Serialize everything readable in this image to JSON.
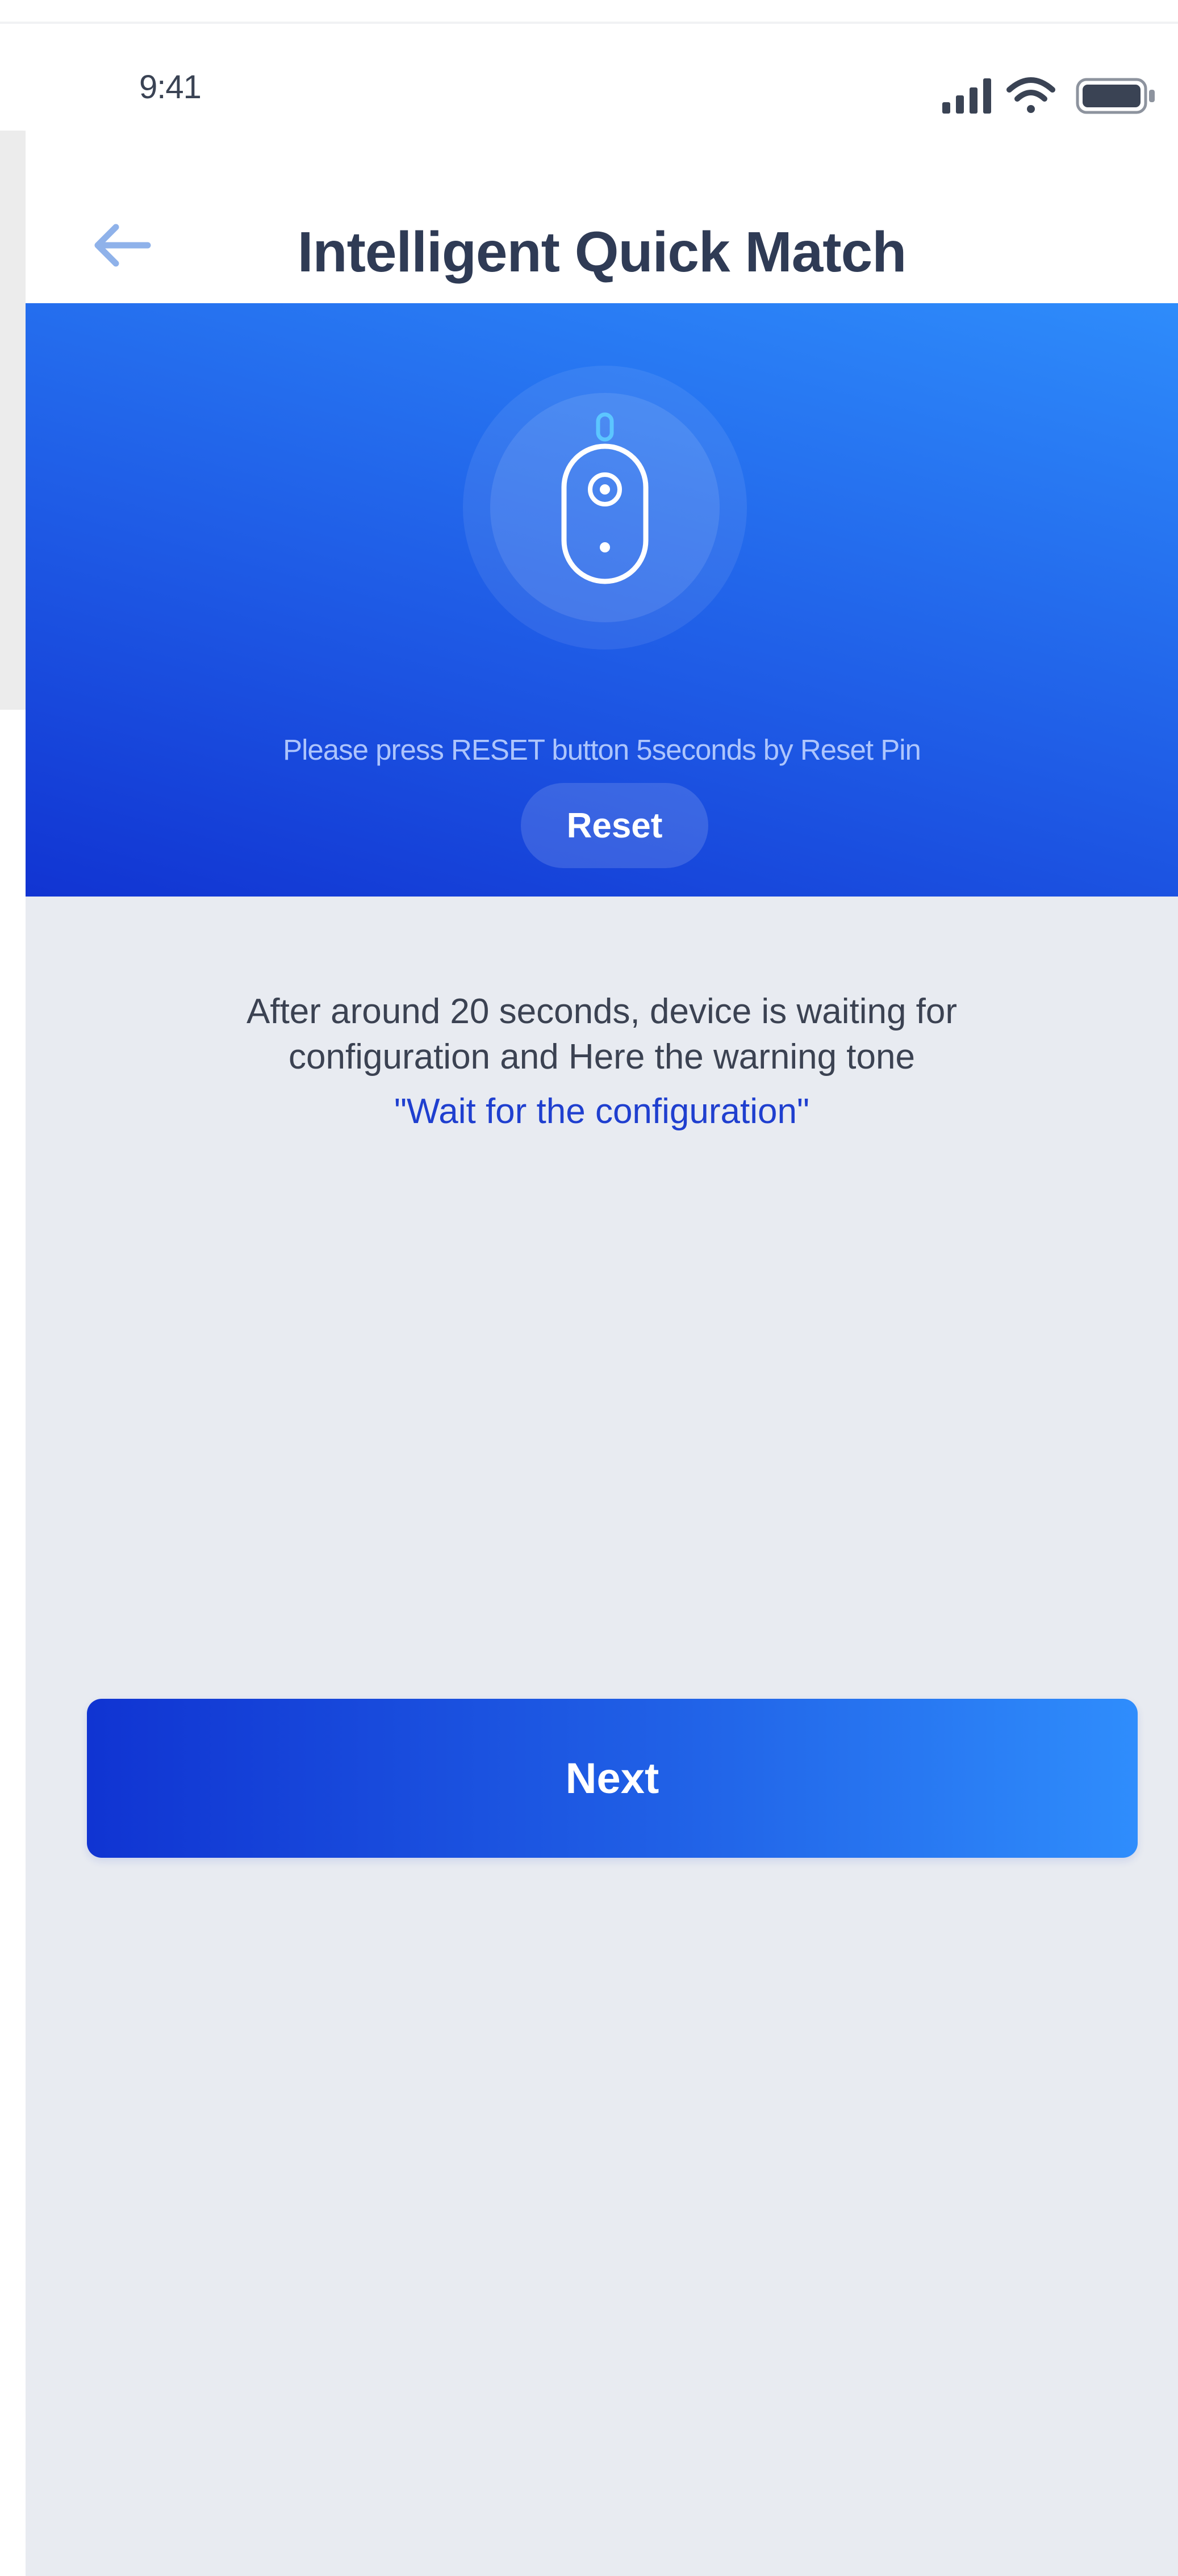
{
  "status_bar": {
    "time": "9:41",
    "icons": [
      "signal-icon",
      "wifi-icon",
      "battery-icon"
    ]
  },
  "header": {
    "title": "Intelligent Quick Match",
    "back_icon": "back-arrow-icon"
  },
  "banner": {
    "device_icon": "device-icon",
    "instruction": "Please press RESET button 5seconds by Reset Pin",
    "reset_label": "Reset",
    "colors": {
      "gradient_start": "#1134d2",
      "gradient_end": "#2e8cfb"
    }
  },
  "content": {
    "description_line1": "After around 20 seconds, device is waiting for",
    "description_line2": "configuration and Here the warning tone",
    "highlight": "\"Wait for the configuration\"",
    "highlight_color": "#1f3fcf"
  },
  "actions": {
    "next_label": "Next"
  }
}
